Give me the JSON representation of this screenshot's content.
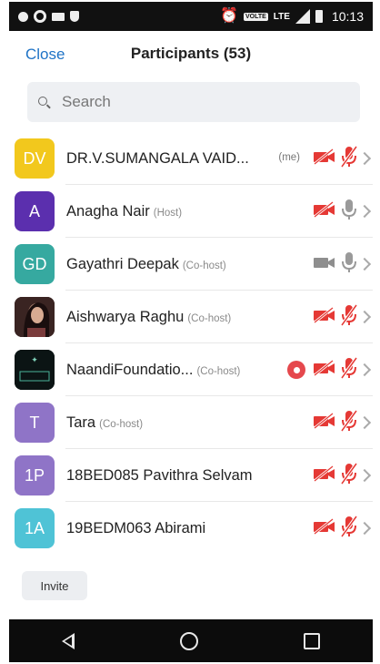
{
  "status_bar": {
    "volte": "VOLTE",
    "network": "LTE",
    "time": "10:13"
  },
  "header": {
    "close_label": "Close",
    "title": "Participants (53)"
  },
  "search": {
    "placeholder": "Search"
  },
  "participants": [
    {
      "initials": "DV",
      "avatar_color": "#f2c81d",
      "name": "DR.V.SUMANGALA VAID...",
      "role": "",
      "me_tag": "(me)",
      "video_icon": "video-off-icon",
      "mic_icon": "mic-off-icon"
    },
    {
      "initials": "A",
      "avatar_color": "#5b2fae",
      "name": "Anagha Nair",
      "role": "(Host)",
      "video_icon": "video-off-icon",
      "mic_icon": "mic-on-icon"
    },
    {
      "initials": "GD",
      "avatar_color": "#36a9a0",
      "name": "Gayathri Deepak",
      "role": "(Co-host)",
      "video_icon": "video-on-icon",
      "mic_icon": "mic-on-icon"
    },
    {
      "initials": "",
      "avatar_color": "#2b1b1b",
      "avatar_photo": "photo",
      "name": "Aishwarya Raghu",
      "role": "(Co-host)",
      "video_icon": "video-off-icon",
      "mic_icon": "mic-off-icon"
    },
    {
      "initials": "",
      "avatar_color": "#0b1414",
      "avatar_photo": "logo",
      "name": "NaandiFoundatio...",
      "role": "(Co-host)",
      "recording_icon": "recording-icon",
      "video_icon": "video-off-icon",
      "mic_icon": "mic-off-icon"
    },
    {
      "initials": "T",
      "avatar_color": "#8f74c7",
      "name": "Tara",
      "role": "(Co-host)",
      "video_icon": "video-off-icon",
      "mic_icon": "mic-off-icon"
    },
    {
      "initials": "1P",
      "avatar_color": "#8f74c7",
      "name": "18BED085 Pavithra Selvam",
      "role": "",
      "video_icon": "video-off-icon",
      "mic_icon": "mic-off-icon"
    },
    {
      "initials": "1A",
      "avatar_color": "#4fc3d6",
      "name": "19BEDM063 Abirami",
      "role": "",
      "video_icon": "video-off-icon",
      "mic_icon": "mic-off-icon"
    }
  ],
  "footer": {
    "invite_label": "Invite"
  },
  "colors": {
    "accent": "#1f73c6",
    "muted_red": "#e53935",
    "icon_gray": "#9a9a9a"
  }
}
